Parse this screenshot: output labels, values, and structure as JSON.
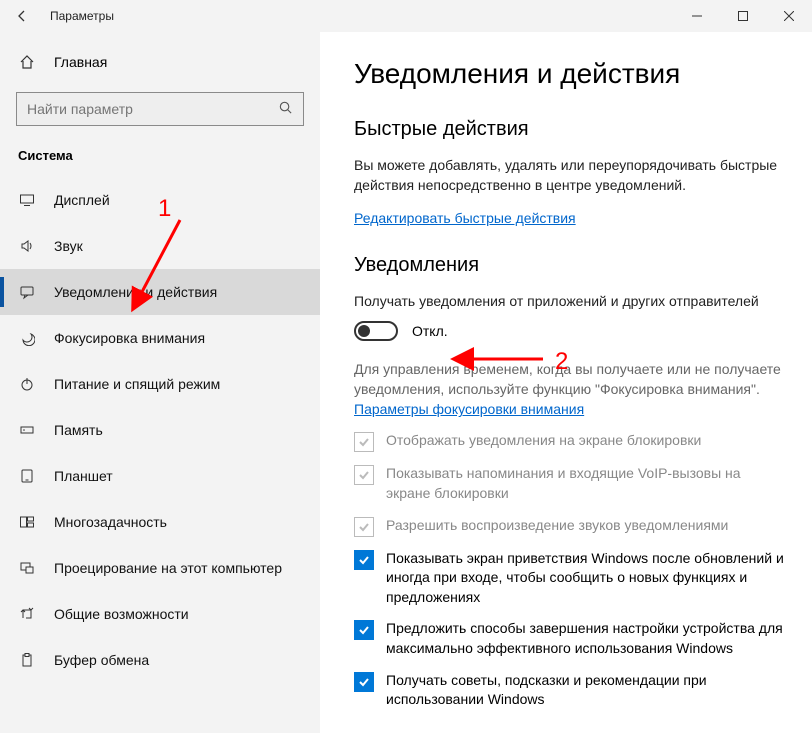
{
  "window": {
    "title": "Параметры"
  },
  "sidebar": {
    "home": "Главная",
    "search_placeholder": "Найти параметр",
    "section": "Система",
    "items": [
      {
        "label": "Дисплей"
      },
      {
        "label": "Звук"
      },
      {
        "label": "Уведомления и действия"
      },
      {
        "label": "Фокусировка внимания"
      },
      {
        "label": "Питание и спящий режим"
      },
      {
        "label": "Память"
      },
      {
        "label": "Планшет"
      },
      {
        "label": "Многозадачность"
      },
      {
        "label": "Проецирование на этот компьютер"
      },
      {
        "label": "Общие возможности"
      },
      {
        "label": "Буфер обмена"
      }
    ],
    "selected_index": 2
  },
  "content": {
    "title": "Уведомления и действия",
    "quick": {
      "heading": "Быстрые действия",
      "desc": "Вы можете добавлять, удалять или переупорядочивать быстрые действия непосредственно в центре уведомлений.",
      "link": "Редактировать быстрые действия"
    },
    "notifications": {
      "heading": "Уведомления",
      "toggle_caption": "Получать уведомления от приложений и других отправителей",
      "toggle_state": "Откл.",
      "focus_desc": "Для управления временем, когда вы получаете или не получаете уведомления, используйте функцию \"Фокусировка внимания\".",
      "focus_link": "Параметры фокусировки внимания",
      "checks": [
        {
          "label": "Отображать уведомления на экране блокировки",
          "checked": false,
          "disabled": true
        },
        {
          "label": "Показывать напоминания и входящие VoIP-вызовы на экране блокировки",
          "checked": false,
          "disabled": true
        },
        {
          "label": "Разрешить  воспроизведение звуков уведомлениями",
          "checked": false,
          "disabled": true
        },
        {
          "label": "Показывать экран приветствия Windows после обновлений и иногда при входе, чтобы сообщить о новых функциях и предложениях",
          "checked": true,
          "disabled": false
        },
        {
          "label": "Предложить способы завершения настройки устройства для максимально эффективного использования Windows",
          "checked": true,
          "disabled": false
        },
        {
          "label": "Получать советы, подсказки и рекомендации при использовании Windows",
          "checked": true,
          "disabled": false
        }
      ]
    }
  },
  "annotations": {
    "n1": "1",
    "n2": "2"
  }
}
